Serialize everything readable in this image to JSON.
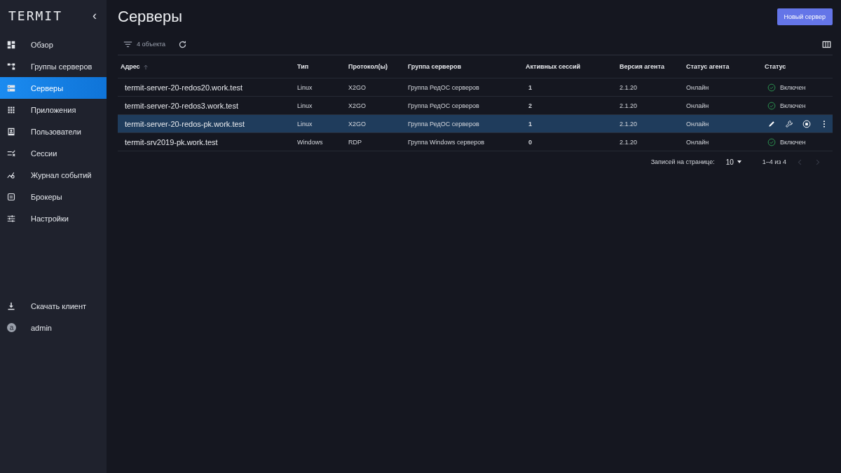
{
  "sidebar": {
    "logo": "TERMIT",
    "collapse": "‹",
    "items": [
      {
        "label": "Обзор",
        "selected": false
      },
      {
        "label": "Группы серверов",
        "selected": false
      },
      {
        "label": "Серверы",
        "selected": true
      },
      {
        "label": "Приложения",
        "selected": false
      },
      {
        "label": "Пользователи",
        "selected": false
      },
      {
        "label": "Сессии",
        "selected": false
      },
      {
        "label": "Журнал событий",
        "selected": false
      },
      {
        "label": "Брокеры",
        "selected": false
      },
      {
        "label": "Настройки",
        "selected": false
      }
    ],
    "download": "Скачать клиент",
    "user": {
      "avatar": "a",
      "name": "admin"
    }
  },
  "page": {
    "title": "Серверы",
    "new_button": "Новый сервер",
    "count": "4 объекта"
  },
  "table": {
    "columns": [
      "Адрес",
      "Тип",
      "Протокол(ы)",
      "Группа серверов",
      "Активных сессий",
      "Версия агента",
      "Статус агента",
      "Статус"
    ],
    "rows": [
      {
        "address": "termit-server-20-redos20.work.test",
        "type": "Linux",
        "protocol": "X2GO",
        "group": "Группа РедОС серверов",
        "sessions": "1",
        "version": "2.1.20",
        "agent": "Онлайн",
        "status": "Включен",
        "selected": false
      },
      {
        "address": "termit-server-20-redos3.work.test",
        "type": "Linux",
        "protocol": "X2GO",
        "group": "Группа РедОС серверов",
        "sessions": "2",
        "version": "2.1.20",
        "agent": "Онлайн",
        "status": "Включен",
        "selected": false
      },
      {
        "address": "termit-server-20-redos-pk.work.test",
        "type": "Linux",
        "protocol": "X2GO",
        "group": "Группа РедОС серверов",
        "sessions": "1",
        "version": "2.1.20",
        "agent": "Онлайн",
        "selected": true
      },
      {
        "address": "termit-srv2019-pk.work.test",
        "type": "Windows",
        "protocol": "RDP",
        "group": "Группа Windows серверов",
        "sessions": "0",
        "version": "2.1.20",
        "agent": "Онлайн",
        "status": "Включен",
        "selected": false
      }
    ]
  },
  "pagination": {
    "label": "Записей на странице:",
    "per_page": "10",
    "range": "1–4 из 4"
  }
}
